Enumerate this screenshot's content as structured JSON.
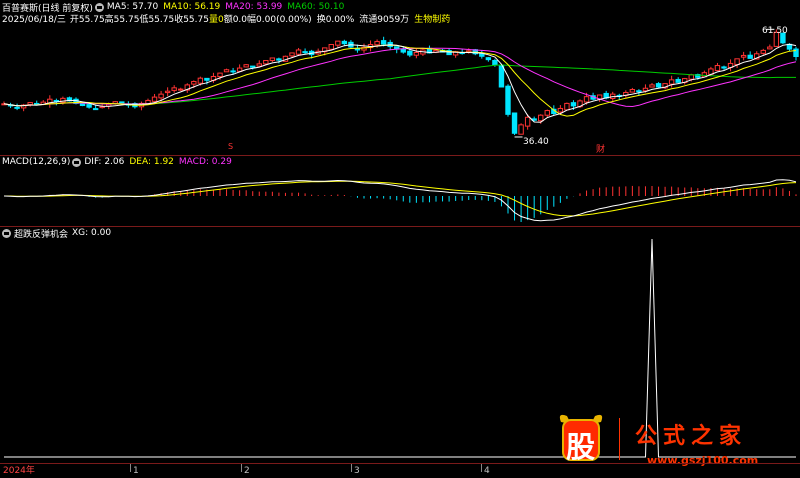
{
  "colors": {
    "background": "#000000",
    "up": "#ff3333",
    "down": "#00e5ff",
    "ma5": "#ffffff",
    "ma10": "#ffff00",
    "ma20": "#ff33ff",
    "ma60": "#00cc00",
    "divider": "#7a1a1a",
    "text": "#dddddd"
  },
  "header": {
    "stock_title": "百普赛斯(日线 前复权)",
    "ma5_label": "MA5: 57.70",
    "ma10_label": "MA10: 56.19",
    "ma20_label": "MA20: 53.99",
    "ma60_label": "MA60: 50.10",
    "date": "2025/06/18/三",
    "open": "开55.75",
    "high": "高55.75",
    "low": "低55.75",
    "close": "收55.75",
    "volume": "量0",
    "amount": "额0.0",
    "change": "幅0.00(0.00%)",
    "turnover": "换0.00%",
    "float_shares": "流通9059万",
    "industry": "生物制药"
  },
  "price_panel": {
    "high_marker": "61.50",
    "low_marker": "36.40",
    "tag_fin": "财",
    "tag_left": "S"
  },
  "macd_panel": {
    "title": "MACD(12,26,9)",
    "dif": "DIF: 2.06",
    "dea": "DEA: 1.92",
    "macd": "MACD: 0.29"
  },
  "xg_panel": {
    "title": "超跌反弹机会",
    "xg": "XG: 0.00"
  },
  "time_axis": [
    "2024年",
    "1",
    "2",
    "3",
    "4"
  ],
  "watermark": {
    "big_char": "股",
    "title": "公式之家",
    "url": "www.gszj100.com"
  },
  "chart_data": {
    "type": "line",
    "close_prices": [
      44.5,
      44.0,
      43.6,
      44.2,
      44.8,
      44.3,
      44.9,
      45.6,
      45.1,
      45.8,
      45.2,
      44.6,
      44.1,
      43.7,
      43.3,
      43.9,
      44.4,
      45.0,
      44.5,
      44.2,
      43.8,
      44.6,
      45.3,
      46.1,
      46.8,
      47.5,
      48.3,
      48.0,
      49.0,
      49.8,
      50.6,
      50.1,
      51.0,
      51.8,
      52.6,
      52.1,
      53.0,
      53.8,
      53.2,
      54.0,
      54.8,
      55.4,
      54.9,
      55.8,
      56.6,
      57.3,
      56.8,
      56.2,
      57.0,
      57.8,
      58.6,
      59.4,
      58.8,
      58.0,
      57.3,
      57.9,
      58.6,
      59.3,
      58.7,
      58.1,
      57.5,
      56.8,
      56.1,
      56.7,
      57.3,
      56.6,
      57.2,
      56.8,
      56.2,
      56.9,
      56.5,
      57.1,
      56.4,
      55.8,
      55.0,
      53.8,
      48.5,
      42.0,
      37.5,
      39.5,
      41.3,
      40.6,
      41.8,
      42.9,
      42.2,
      43.4,
      44.6,
      44.0,
      45.2,
      46.2,
      45.6,
      46.6,
      45.9,
      46.8,
      46.3,
      47.2,
      47.9,
      47.4,
      48.2,
      49.0,
      48.5,
      49.3,
      50.2,
      49.6,
      50.5,
      51.4,
      50.8,
      51.9,
      52.8,
      53.6,
      53.0,
      54.1,
      55.2,
      56.0,
      55.3,
      56.4,
      57.2,
      58.0,
      61.5,
      59.0,
      57.5,
      55.75
    ],
    "xg_spike_index": 99,
    "xlabel": "",
    "ylabel": ""
  }
}
